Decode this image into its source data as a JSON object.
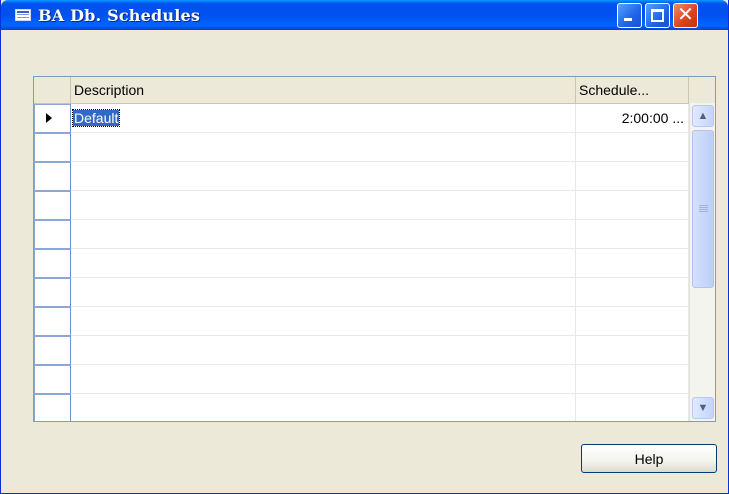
{
  "window": {
    "title": "BA Db. Schedules",
    "title_icon": "table-icon"
  },
  "titlebar_buttons": {
    "minimize": "minimize-icon",
    "maximize": "maximize-icon",
    "close": "close-icon",
    "close_glyph": "✕"
  },
  "grid": {
    "columns": [
      "Description",
      "Schedule..."
    ],
    "rows": [
      {
        "description": "Default",
        "schedule": "2:00:00 ..."
      }
    ],
    "empty_row_count": 10
  },
  "scrollbar": {
    "up_glyph": "▲",
    "down_glyph": "▼"
  },
  "buttons": {
    "help": "Help"
  },
  "colors": {
    "title_bar": "#0055ea",
    "selection": "#316ac5",
    "window_bg": "#ece9d8"
  }
}
